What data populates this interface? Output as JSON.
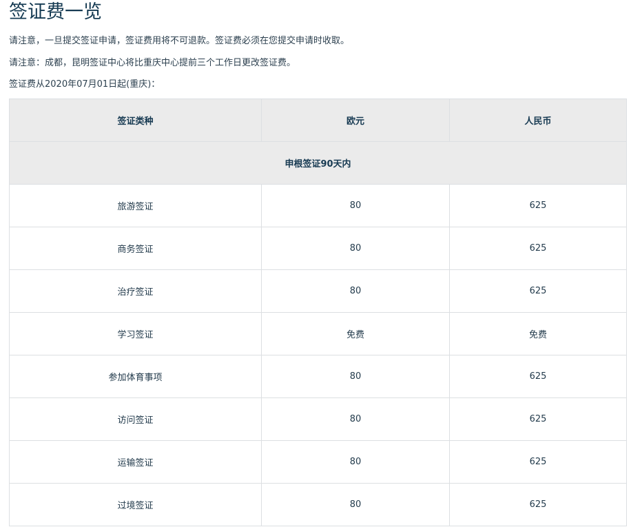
{
  "title": "签证费一览",
  "notes": [
    "请注意，一旦提交签证申请，签证费用将不可退款。签证费必须在您提交申请时收取。",
    "请注意：成都，昆明签证中心将比重庆中心提前三个工作日更改签证费。",
    "签证费从2020年07月01日起(重庆)："
  ],
  "table": {
    "headers": [
      "签证类种",
      "欧元",
      "人民币"
    ],
    "section": "申根签证90天内",
    "rows": [
      {
        "type": "旅游签证",
        "eur": "80",
        "cny": "625"
      },
      {
        "type": "商务签证",
        "eur": "80",
        "cny": "625"
      },
      {
        "type": "治疗签证",
        "eur": "80",
        "cny": "625"
      },
      {
        "type": "学习签证",
        "eur": "免费",
        "cny": "免费"
      },
      {
        "type": "参加体育事项",
        "eur": "80",
        "cny": "625"
      },
      {
        "type": "访问签证",
        "eur": "80",
        "cny": "625"
      },
      {
        "type": "运输签证",
        "eur": "80",
        "cny": "625"
      },
      {
        "type": "过境签证",
        "eur": "80",
        "cny": "625"
      }
    ]
  }
}
